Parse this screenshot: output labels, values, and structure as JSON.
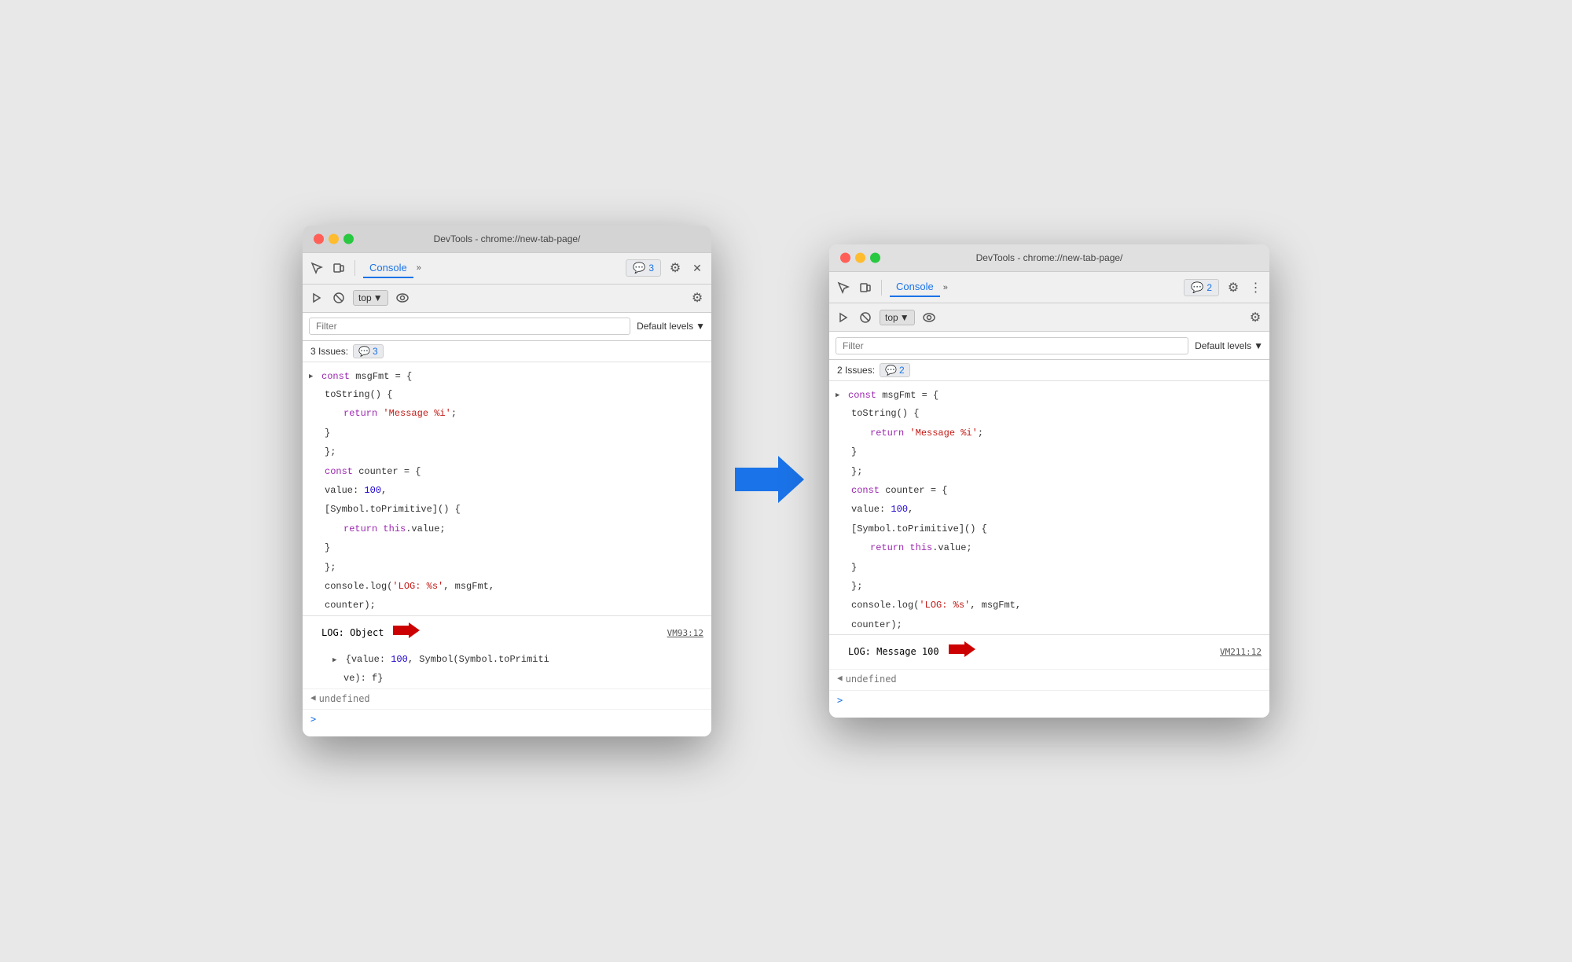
{
  "left_window": {
    "title_bar": {
      "title": "DevTools - chrome://new-tab-page/"
    },
    "toolbar": {
      "tab_label": "Console",
      "chevron": "»",
      "issues_count": "3",
      "gear_label": "⚙"
    },
    "secondary_toolbar": {
      "top_label": "top",
      "dropdown_arrow": "▼"
    },
    "filter": {
      "placeholder": "Filter",
      "levels_label": "Default levels",
      "levels_arrow": "▼"
    },
    "issues_bar": {
      "label": "3 Issues:",
      "badge_count": "3"
    },
    "code": {
      "line1": "const msgFmt = {",
      "line2": "    toString() {",
      "line3_kw": "return",
      "line3_str": "'Message %i'",
      "line3_end": ";",
      "line4": "    }",
      "line5": "};",
      "line6": "const counter = {",
      "line7_plain": "    value: ",
      "line7_num": "100",
      "line7_end": ",",
      "line8": "    [Symbol.toPrimitive]() {",
      "line9_kw": "return",
      "line9_kw2": "this",
      "line9_rest": ".value;",
      "line10": "    }",
      "line11": "};",
      "line12": "console.log(",
      "line12_str": "'LOG: %s'",
      "line12_rest": ", msgFmt,",
      "line13": "counter);"
    },
    "log_output": {
      "label": "LOG: Object",
      "vm_link": "VM93:12",
      "obj_line1": "{value: ",
      "obj_num": "100",
      "obj_line1_rest": ", Symbol(Symbol.toPrimiti",
      "obj_line2": "ve): f}"
    },
    "undefined_label": "undefined",
    "prompt": ">"
  },
  "right_window": {
    "title_bar": {
      "title": "DevTools - chrome://new-tab-page/"
    },
    "toolbar": {
      "tab_label": "Console",
      "chevron": "»",
      "issues_count": "2",
      "gear_label": "⚙",
      "three_dots": "⋮"
    },
    "secondary_toolbar": {
      "top_label": "top",
      "dropdown_arrow": "▼"
    },
    "filter": {
      "placeholder": "Filter",
      "levels_label": "Default levels",
      "levels_arrow": "▼"
    },
    "issues_bar": {
      "label": "2 Issues:",
      "badge_count": "2"
    },
    "code": {
      "line1": "const msgFmt = {",
      "line2": "    toString() {",
      "line3_kw": "return",
      "line3_str": "'Message %i'",
      "line3_end": ";",
      "line4": "    }",
      "line5": "};",
      "line6": "const counter = {",
      "line7_plain": "    value: ",
      "line7_num": "100",
      "line7_end": ",",
      "line8": "    [Symbol.toPrimitive]() {",
      "line9_kw": "return",
      "line9_kw2": "this",
      "line9_rest": ".value;",
      "line10": "    }",
      "line11": "};",
      "line12": "console.log(",
      "line12_str": "'LOG: %s'",
      "line12_rest": ", msgFmt,",
      "line13": "counter);"
    },
    "log_output": {
      "label": "LOG: Message 100",
      "vm_link": "VM211:12"
    },
    "undefined_label": "undefined",
    "prompt": ">"
  },
  "blue_arrow": "→"
}
